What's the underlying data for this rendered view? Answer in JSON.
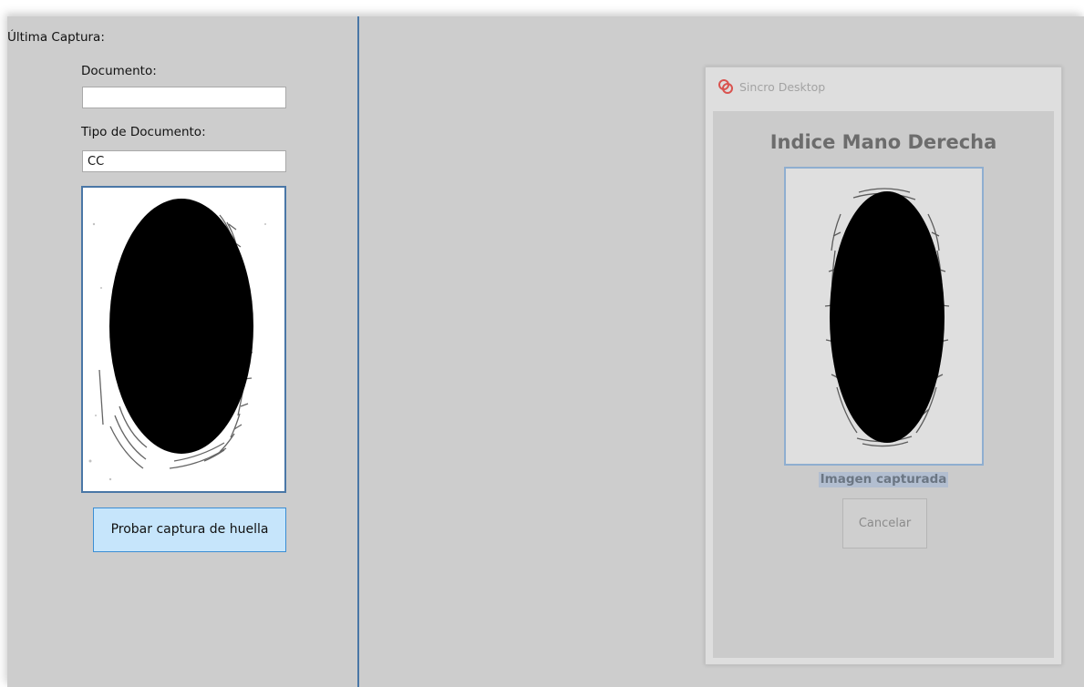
{
  "left_panel": {
    "title": "Última Captura:",
    "document_label": "Documento:",
    "document_value": "",
    "document_type_label": "Tipo de Documento:",
    "document_type_value": "CC",
    "test_button_label": "Probar captura de huella"
  },
  "dialog": {
    "title": "Sincro Desktop",
    "app_icon": "sincro-logo-icon",
    "finger_heading": "Indice Mano Derecha",
    "caption": "Imagen capturada",
    "cancel_label": "Cancelar"
  },
  "colors": {
    "window_bg": "#cdcdcd",
    "divider": "#4a77a6",
    "button_bg": "#c6e5fb",
    "button_border": "#3b8ed4",
    "logo_red": "#d9534f"
  }
}
